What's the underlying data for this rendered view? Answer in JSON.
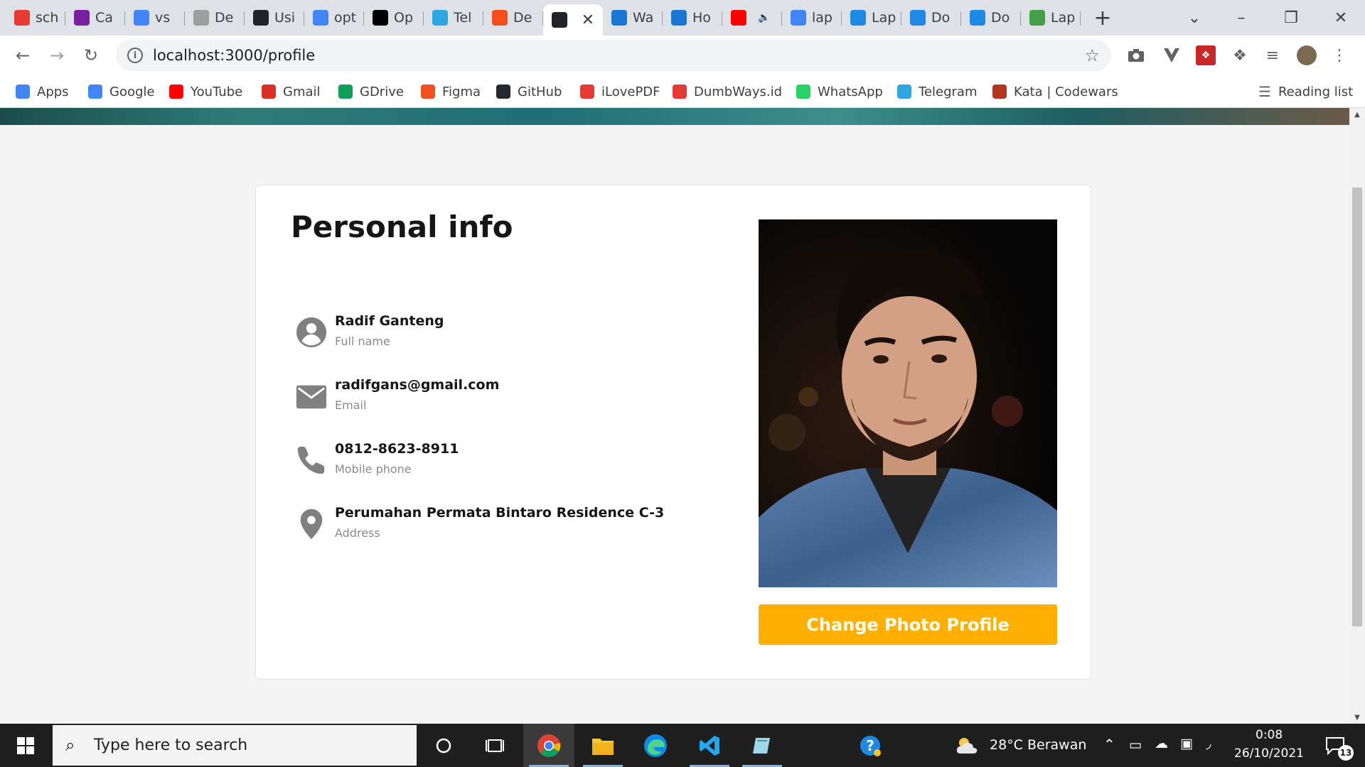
{
  "browser": {
    "tabs": [
      {
        "icon": "dumbways-icon",
        "label": "sch",
        "color": "#e53935"
      },
      {
        "icon": "bootstrap-icon",
        "label": "Ca",
        "color": "#7b1fa2"
      },
      {
        "icon": "google-icon",
        "label": "vs",
        "color": "#4285f4"
      },
      {
        "icon": "codepen-icon",
        "label": "De",
        "color": "#9e9e9e"
      },
      {
        "icon": "react-icon",
        "label": "Usi",
        "color": "#20232a"
      },
      {
        "icon": "google-icon",
        "label": "opt",
        "color": "#4285f4"
      },
      {
        "icon": "openai-icon",
        "label": "Op",
        "color": "#000000"
      },
      {
        "icon": "telegram-icon",
        "label": "Tel",
        "color": "#2ca5e0"
      },
      {
        "icon": "figma-icon",
        "label": "De",
        "color": "#f24e1e"
      },
      {
        "icon": "react-icon",
        "label": "",
        "color": "#20232a",
        "active": true
      },
      {
        "icon": "copilot-icon",
        "label": "Wa",
        "color": "#1976d2"
      },
      {
        "icon": "copilot-icon",
        "label": "Ho",
        "color": "#1976d2"
      },
      {
        "icon": "youtube-icon",
        "label": "",
        "color": "#ff0000",
        "audio": true
      },
      {
        "icon": "google-icon",
        "label": "lap",
        "color": "#4285f4"
      },
      {
        "icon": "wordpress-icon",
        "label": "Lap",
        "color": "#1e88e5"
      },
      {
        "icon": "wordpress-icon",
        "label": "Do",
        "color": "#1e88e5"
      },
      {
        "icon": "wordpress-icon",
        "label": "Do",
        "color": "#1e88e5"
      },
      {
        "icon": "paper-icon",
        "label": "Lap",
        "color": "#43a047"
      }
    ],
    "url": "localhost:3000/profile",
    "bookmarks": [
      {
        "icon": "apps-icon",
        "label": "Apps",
        "color": "#4285f4"
      },
      {
        "icon": "google-icon",
        "label": "Google",
        "color": "#4285f4"
      },
      {
        "icon": "youtube-icon",
        "label": "YouTube",
        "color": "#ff0000"
      },
      {
        "icon": "gmail-icon",
        "label": "Gmail",
        "color": "#d93025"
      },
      {
        "icon": "gdrive-icon",
        "label": "GDrive",
        "color": "#0f9d58"
      },
      {
        "icon": "figma-icon",
        "label": "Figma",
        "color": "#f24e1e"
      },
      {
        "icon": "github-icon",
        "label": "GitHub",
        "color": "#24292e"
      },
      {
        "icon": "ilovepdf-icon",
        "label": "iLovePDF",
        "color": "#e53935"
      },
      {
        "icon": "dumbways-icon",
        "label": "DumbWays.id",
        "color": "#e53935"
      },
      {
        "icon": "whatsapp-icon",
        "label": "WhatsApp",
        "color": "#25d366"
      },
      {
        "icon": "telegram-icon",
        "label": "Telegram",
        "color": "#2ca5e0"
      },
      {
        "icon": "codewars-icon",
        "label": "Kata | Codewars",
        "color": "#b1361e"
      }
    ],
    "reading_list": "Reading list"
  },
  "profile": {
    "title": "Personal info",
    "fields": [
      {
        "icon": "user-icon",
        "value": "Radif Ganteng",
        "label": "Full name"
      },
      {
        "icon": "mail-icon",
        "value": "radifgans@gmail.com",
        "label": "Email"
      },
      {
        "icon": "phone-icon",
        "value": "0812-8623-8911",
        "label": "Mobile phone"
      },
      {
        "icon": "location-pin-icon",
        "value": "Perumahan Permata Bintaro Residence C-3",
        "label": "Address"
      }
    ],
    "change_photo_label": "Change Photo Profile",
    "accent_color": "#ffaf00"
  },
  "taskbar": {
    "search_placeholder": "Type here to search",
    "weather": "28°C  Berawan",
    "time": "0:08",
    "date": "26/10/2021",
    "notification_count": "13"
  }
}
